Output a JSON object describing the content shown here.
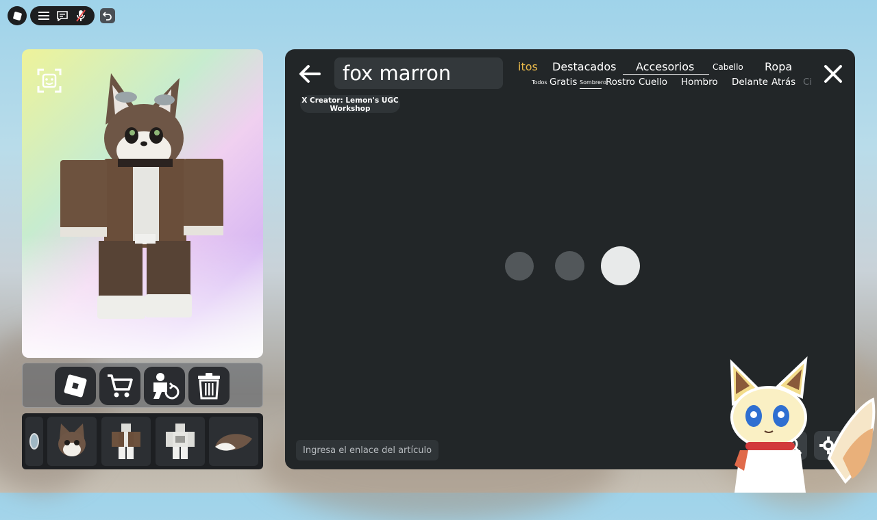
{
  "colors": {
    "panel_bg": "#222628",
    "accent_tab": "#e8b84a",
    "text": "#ffffff",
    "dot_dim": "#52575a",
    "dot_active": "#e8eaea"
  },
  "top_bar": {
    "logo_icon": "roblox-logo-icon",
    "menu_icons": [
      "hamburger-menu-icon",
      "chat-icon",
      "microphone-muted-icon"
    ],
    "undo_icon": "undo-icon"
  },
  "preview": {
    "face_icon": "face-tracking-icon"
  },
  "action_bar": {
    "buttons": [
      "roblox-icon",
      "cart-icon",
      "avatar-swap-icon",
      "trash-icon"
    ]
  },
  "items": {
    "tiles": [
      "mirror-item",
      "fox-head-item",
      "brown-jacket-item",
      "white-shirt-item",
      "fox-tail-item"
    ]
  },
  "search": {
    "value": "fox marron"
  },
  "creator_chip": {
    "label": "X Creator: Lemon's UGC Workshop"
  },
  "categories": [
    {
      "label": "itos",
      "active_color": true
    },
    {
      "label": "Destacados"
    },
    {
      "label": "Accesorios",
      "selected": true
    },
    {
      "label": "Cabello",
      "small": true
    },
    {
      "label": "Ropa"
    }
  ],
  "subcategories": [
    {
      "label": "Todos",
      "tiny": true
    },
    {
      "label": "Gratis"
    },
    {
      "label": "Sombrero",
      "tiny": true,
      "selected": true
    },
    {
      "label": "Rostro"
    },
    {
      "label": "Cuello"
    },
    {
      "label": "Hombro"
    },
    {
      "label": "Delante"
    },
    {
      "label": "Atrás"
    },
    {
      "label": "Ci"
    }
  ],
  "loading": {
    "dots": 3,
    "active_index": 2
  },
  "link_input": {
    "placeholder": "Ingresa el enlace del artículo.."
  }
}
